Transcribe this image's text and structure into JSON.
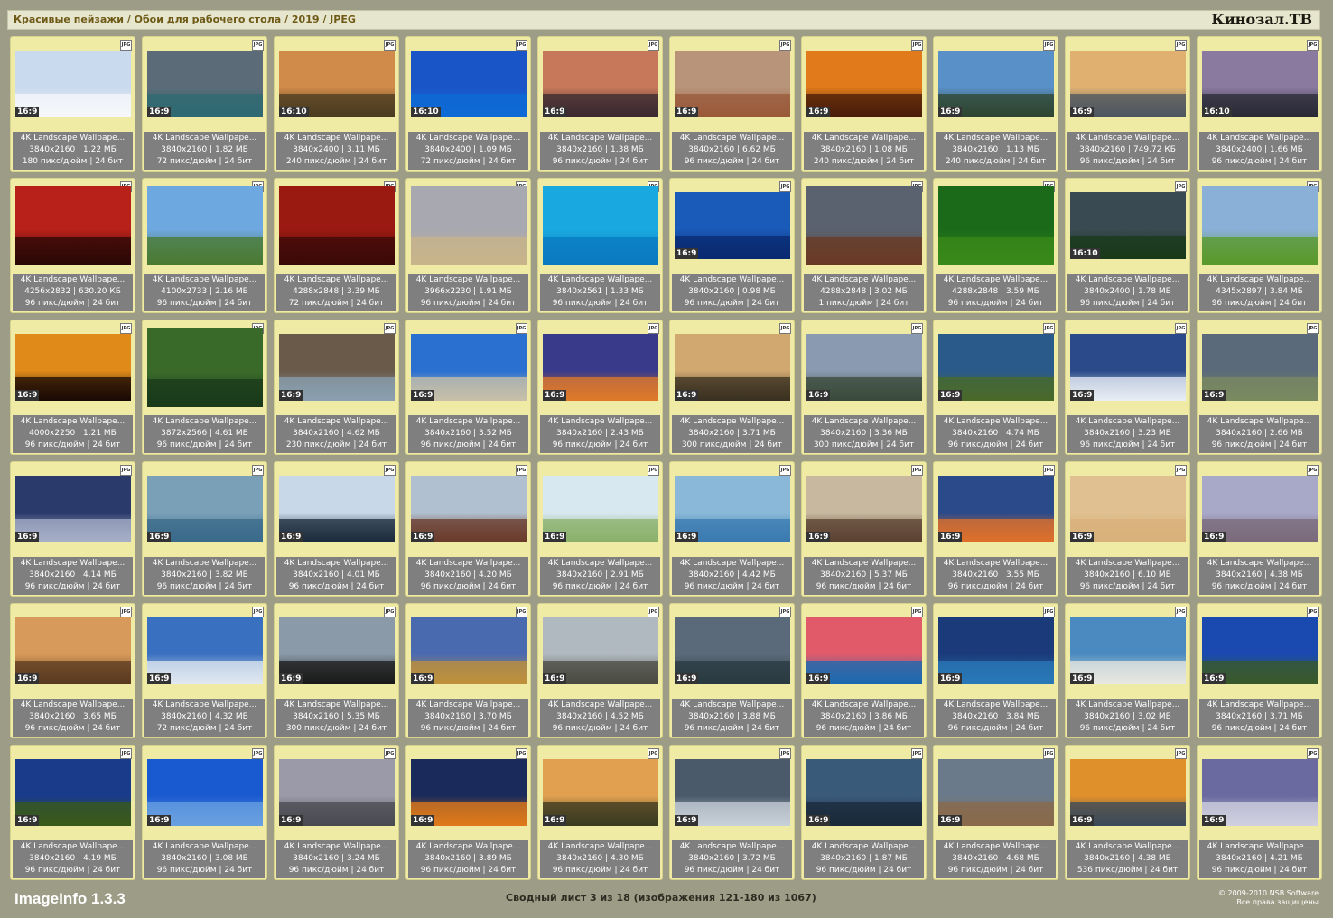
{
  "header": {
    "breadcrumb": "Красивые пейзажи / Обои для рабочего стола / 2019 / JPEG",
    "brand": "Кинозал.ТВ"
  },
  "badge_label": "JPG",
  "thumbnails": [
    {
      "title": "4K Landscape Wallpape...",
      "ratio": "16:9",
      "dims": "3840x2160 | 1.22 МБ",
      "meta": "180 пикс/дюйм | 24 бит",
      "sky": "#c9d9ee",
      "ground": "#f5f7fa"
    },
    {
      "title": "4K Landscape Wallpape...",
      "ratio": "16:9",
      "dims": "3840x2160 | 1.82 МБ",
      "meta": "72 пикс/дюйм | 24 бит",
      "sky": "#5b6b78",
      "ground": "#2f6a72"
    },
    {
      "title": "4K Landscape Wallpape...",
      "ratio": "16:10",
      "dims": "3840x2400 | 3.11 МБ",
      "meta": "240 пикс/дюйм | 24 бит",
      "sky": "#d08a4a",
      "ground": "#4a3b20"
    },
    {
      "title": "4K Landscape Wallpape...",
      "ratio": "16:10",
      "dims": "3840x2400 | 1.09 МБ",
      "meta": "72 пикс/дюйм | 24 бит",
      "sky": "#1a55c8",
      "ground": "#0e6bd6"
    },
    {
      "title": "4K Landscape Wallpape...",
      "ratio": "16:9",
      "dims": "3840x2160 | 1.38 МБ",
      "meta": "96 пикс/дюйм | 24 бит",
      "sky": "#c8785a",
      "ground": "#3a2a30"
    },
    {
      "title": "4K Landscape Wallpape...",
      "ratio": "16:9",
      "dims": "3840x2160 | 6.62 МБ",
      "meta": "96 пикс/дюйм | 24 бит",
      "sky": "#b8947a",
      "ground": "#9a5a3a"
    },
    {
      "title": "4K Landscape Wallpape...",
      "ratio": "16:9",
      "dims": "3840x2160 | 1.08 МБ",
      "meta": "240 пикс/дюйм | 24 бит",
      "sky": "#e07a1a",
      "ground": "#4a1c0a"
    },
    {
      "title": "4K Landscape Wallpape...",
      "ratio": "16:9",
      "dims": "3840x2160 | 1.13 МБ",
      "meta": "240 пикс/дюйм | 24 бит",
      "sky": "#5a90c8",
      "ground": "#2f4630"
    },
    {
      "title": "4K Landscape Wallpape...",
      "ratio": "16:9",
      "dims": "3840x2160 | 749.72 КБ",
      "meta": "96 пикс/дюйм | 24 бит",
      "sky": "#e0b070",
      "ground": "#4c5560"
    },
    {
      "title": "4K Landscape Wallpape...",
      "ratio": "16:10",
      "dims": "3840x2400 | 1.66 МБ",
      "meta": "96 пикс/дюйм | 24 бит",
      "sky": "#8a7aa0",
      "ground": "#2a2a36"
    },
    {
      "title": "4K Landscape Wallpape...",
      "ratio": "",
      "dims": "4256x2832 | 630.20 КБ",
      "meta": "96 пикс/дюйм | 24 бит",
      "sky": "#b8201a",
      "ground": "#2a0806"
    },
    {
      "title": "4K Landscape Wallpape...",
      "ratio": "",
      "dims": "4100x2733 | 2.16 МБ",
      "meta": "96 пикс/дюйм | 24 бит",
      "sky": "#6ea8e0",
      "ground": "#4a7a30"
    },
    {
      "title": "4K Landscape Wallpape...",
      "ratio": "",
      "dims": "4288x2848 | 3.39 МБ",
      "meta": "72 пикс/дюйм | 24 бит",
      "sky": "#9a1a12",
      "ground": "#3a0a08"
    },
    {
      "title": "4K Landscape Wallpape...",
      "ratio": "",
      "dims": "3966x2230 | 1.91 МБ",
      "meta": "96 пикс/дюйм | 24 бит",
      "sky": "#a8a8b0",
      "ground": "#c8b48a"
    },
    {
      "title": "4K Landscape Wallpape...",
      "ratio": "",
      "dims": "3840x2561 | 1.33 МБ",
      "meta": "96 пикс/дюйм | 24 бит",
      "sky": "#1aa8e0",
      "ground": "#0a7ac0"
    },
    {
      "title": "4K Landscape Wallpape...",
      "ratio": "16:9",
      "dims": "3840x2160 | 0.98 МБ",
      "meta": "96 пикс/дюйм | 24 бит",
      "sky": "#1a5ab8",
      "ground": "#0a2a70"
    },
    {
      "title": "4K Landscape Wallpape...",
      "ratio": "",
      "dims": "4288x2848 | 3.02 МБ",
      "meta": "1 пикс/дюйм | 24 бит",
      "sky": "#5a6270",
      "ground": "#6a3a24"
    },
    {
      "title": "4K Landscape Wallpape...",
      "ratio": "",
      "dims": "4288x2848 | 3.59 МБ",
      "meta": "96 пикс/дюйм | 24 бит",
      "sky": "#1a6a1a",
      "ground": "#3a8a1a"
    },
    {
      "title": "4K Landscape Wallpape...",
      "ratio": "16:10",
      "dims": "3840x2400 | 1.78 МБ",
      "meta": "96 пикс/дюйм | 24 бит",
      "sky": "#3a4a52",
      "ground": "#1a3a1a"
    },
    {
      "title": "4K Landscape Wallpape...",
      "ratio": "",
      "dims": "4345x2897 | 3.84 МБ",
      "meta": "96 пикс/дюйм | 24 бит",
      "sky": "#8ab0d8",
      "ground": "#5a9a2a"
    },
    {
      "title": "4K Landscape Wallpape...",
      "ratio": "16:9",
      "dims": "4000x2250 | 1.21 МБ",
      "meta": "96 пикс/дюйм | 24 бит",
      "sky": "#e08a1a",
      "ground": "#1a0a04"
    },
    {
      "title": "4K Landscape Wallpape...",
      "ratio": "",
      "dims": "3872x2566 | 4.61 МБ",
      "meta": "96 пикс/дюйм | 24 бит",
      "sky": "#3a6a2a",
      "ground": "#1a3a1a"
    },
    {
      "title": "4K Landscape Wallpape...",
      "ratio": "16:9",
      "dims": "3840x2160 | 4.62 МБ",
      "meta": "230 пикс/дюйм | 24 бит",
      "sky": "#6a5a4a",
      "ground": "#8aa0b0"
    },
    {
      "title": "4K Landscape Wallpape...",
      "ratio": "16:9",
      "dims": "3840x2160 | 3.52 МБ",
      "meta": "96 пикс/дюйм | 24 бит",
      "sky": "#2a70d0",
      "ground": "#c8c0a8"
    },
    {
      "title": "4K Landscape Wallpape...",
      "ratio": "16:9",
      "dims": "3840x2160 | 2.43 МБ",
      "meta": "96 пикс/дюйм | 24 бит",
      "sky": "#3a3a8a",
      "ground": "#e07a2a"
    },
    {
      "title": "4K Landscape Wallpape...",
      "ratio": "16:9",
      "dims": "3840x2160 | 3.71 МБ",
      "meta": "300 пикс/дюйм | 24 бит",
      "sky": "#d0a870",
      "ground": "#3a3020"
    },
    {
      "title": "4K Landscape Wallpape...",
      "ratio": "16:9",
      "dims": "3840x2160 | 3.36 МБ",
      "meta": "300 пикс/дюйм | 24 бит",
      "sky": "#8a9ab0",
      "ground": "#3a4a3a"
    },
    {
      "title": "4K Landscape Wallpape...",
      "ratio": "16:9",
      "dims": "3840x2160 | 4.74 МБ",
      "meta": "96 пикс/дюйм | 24 бит",
      "sky": "#2a5a8a",
      "ground": "#4a6a2a"
    },
    {
      "title": "4K Landscape Wallpape...",
      "ratio": "16:9",
      "dims": "3840x2160 | 3.23 МБ",
      "meta": "96 пикс/дюйм | 24 бит",
      "sky": "#2a4a8a",
      "ground": "#e8eef4"
    },
    {
      "title": "4K Landscape Wallpape...",
      "ratio": "16:9",
      "dims": "3840x2160 | 2.66 МБ",
      "meta": "96 пикс/дюйм | 24 бит",
      "sky": "#5a6a7a",
      "ground": "#7a8a60"
    },
    {
      "title": "4K Landscape Wallpape...",
      "ratio": "16:9",
      "dims": "3840x2160 | 4.14 МБ",
      "meta": "96 пикс/дюйм | 24 бит",
      "sky": "#2a3a6a",
      "ground": "#a8b0c8"
    },
    {
      "title": "4K Landscape Wallpape...",
      "ratio": "16:9",
      "dims": "3840x2160 | 3.82 МБ",
      "meta": "96 пикс/дюйм | 24 бит",
      "sky": "#7aa0b8",
      "ground": "#3a6a8a"
    },
    {
      "title": "4K Landscape Wallpape...",
      "ratio": "16:9",
      "dims": "3840x2160 | 4.01 МБ",
      "meta": "96 пикс/дюйм | 24 бит",
      "sky": "#c8d8e8",
      "ground": "#1a2a3a"
    },
    {
      "title": "4K Landscape Wallpape...",
      "ratio": "16:9",
      "dims": "3840x2160 | 4.20 МБ",
      "meta": "96 пикс/дюйм | 24 бит",
      "sky": "#b0c0d0",
      "ground": "#6a3a2a"
    },
    {
      "title": "4K Landscape Wallpape...",
      "ratio": "16:9",
      "dims": "3840x2160 | 2.91 МБ",
      "meta": "96 пикс/дюйм | 24 бит",
      "sky": "#d8e8f0",
      "ground": "#8ab06a"
    },
    {
      "title": "4K Landscape Wallpape...",
      "ratio": "16:9",
      "dims": "3840x2160 | 4.42 МБ",
      "meta": "96 пикс/дюйм | 24 бит",
      "sky": "#8ab8d8",
      "ground": "#3a7ab0"
    },
    {
      "title": "4K Landscape Wallpape...",
      "ratio": "16:9",
      "dims": "3840x2160 | 5.37 МБ",
      "meta": "96 пикс/дюйм | 24 бит",
      "sky": "#c8b8a0",
      "ground": "#5a4030"
    },
    {
      "title": "4K Landscape Wallpape...",
      "ratio": "16:9",
      "dims": "3840x2160 | 3.55 МБ",
      "meta": "96 пикс/дюйм | 24 бит",
      "sky": "#2a4a8a",
      "ground": "#e0702a"
    },
    {
      "title": "4K Landscape Wallpape...",
      "ratio": "16:9",
      "dims": "3840x2160 | 6.10 МБ",
      "meta": "96 пикс/дюйм | 24 бит",
      "sky": "#e0c090",
      "ground": "#d8b07a"
    },
    {
      "title": "4K Landscape Wallpape...",
      "ratio": "16:9",
      "dims": "3840x2160 | 4.38 МБ",
      "meta": "96 пикс/дюйм | 24 бит",
      "sky": "#a8a8c8",
      "ground": "#7a6a7a"
    },
    {
      "title": "4K Landscape Wallpape...",
      "ratio": "16:9",
      "dims": "3840x2160 | 3.65 МБ",
      "meta": "96 пикс/дюйм | 24 бит",
      "sky": "#d89a5a",
      "ground": "#5a3a20"
    },
    {
      "title": "4K Landscape Wallpape...",
      "ratio": "16:9",
      "dims": "3840x2160 | 4.32 МБ",
      "meta": "72 пикс/дюйм | 24 бит",
      "sky": "#3a70c0",
      "ground": "#e0e8f0"
    },
    {
      "title": "4K Landscape Wallpape...",
      "ratio": "16:9",
      "dims": "3840x2160 | 5.35 МБ",
      "meta": "300 пикс/дюйм | 24 бит",
      "sky": "#8a9aa8",
      "ground": "#1a1a1a"
    },
    {
      "title": "4K Landscape Wallpape...",
      "ratio": "16:9",
      "dims": "3840x2160 | 3.70 МБ",
      "meta": "96 пикс/дюйм | 24 бит",
      "sky": "#4a6ab0",
      "ground": "#c0903a"
    },
    {
      "title": "4K Landscape Wallpape...",
      "ratio": "16:9",
      "dims": "3840x2160 | 4.52 МБ",
      "meta": "96 пикс/дюйм | 24 бит",
      "sky": "#b0b8c0",
      "ground": "#4a4a40"
    },
    {
      "title": "4K Landscape Wallpape...",
      "ratio": "16:9",
      "dims": "3840x2160 | 3.88 МБ",
      "meta": "96 пикс/дюйм | 24 бит",
      "sky": "#5a6a7a",
      "ground": "#2a3a40"
    },
    {
      "title": "4K Landscape Wallpape...",
      "ratio": "16:9",
      "dims": "3840x2160 | 3.86 МБ",
      "meta": "96 пикс/дюйм | 24 бит",
      "sky": "#e05a6a",
      "ground": "#1a6ab0"
    },
    {
      "title": "4K Landscape Wallpape...",
      "ratio": "16:9",
      "dims": "3840x2160 | 3.84 МБ",
      "meta": "96 пикс/дюйм | 24 бит",
      "sky": "#1a3a7a",
      "ground": "#2a7ab8"
    },
    {
      "title": "4K Landscape Wallpape...",
      "ratio": "16:9",
      "dims": "3840x2160 | 3.02 МБ",
      "meta": "96 пикс/дюйм | 24 бит",
      "sky": "#4a8ac0",
      "ground": "#e8e8e0"
    },
    {
      "title": "4K Landscape Wallpape...",
      "ratio": "16:9",
      "dims": "3840x2160 | 3.71 МБ",
      "meta": "96 пикс/дюйм | 24 бит",
      "sky": "#1a4ab0",
      "ground": "#3a5a2a"
    },
    {
      "title": "4K Landscape Wallpape...",
      "ratio": "16:9",
      "dims": "3840x2160 | 4.19 МБ",
      "meta": "96 пикс/дюйм | 24 бит",
      "sky": "#1a3a8a",
      "ground": "#3a5a1a"
    },
    {
      "title": "4K Landscape Wallpape...",
      "ratio": "16:9",
      "dims": "3840x2160 | 3.08 МБ",
      "meta": "96 пикс/дюйм | 24 бит",
      "sky": "#1a5ad0",
      "ground": "#6aa0e0"
    },
    {
      "title": "4K Landscape Wallpape...",
      "ratio": "16:9",
      "dims": "3840x2160 | 3.24 МБ",
      "meta": "96 пикс/дюйм | 24 бит",
      "sky": "#9a9aa8",
      "ground": "#4a4a50"
    },
    {
      "title": "4K Landscape Wallpape...",
      "ratio": "16:9",
      "dims": "3840x2160 | 3.89 МБ",
      "meta": "96 пикс/дюйм | 24 бит",
      "sky": "#1a2a5a",
      "ground": "#e07a1a"
    },
    {
      "title": "4K Landscape Wallpape...",
      "ratio": "16:9",
      "dims": "3840x2160 | 4.30 МБ",
      "meta": "96 пикс/дюйм | 24 бит",
      "sky": "#e0a050",
      "ground": "#3a3a20"
    },
    {
      "title": "4K Landscape Wallpape...",
      "ratio": "16:9",
      "dims": "3840x2160 | 3.72 МБ",
      "meta": "96 пикс/дюйм | 24 бит",
      "sky": "#4a5a6a",
      "ground": "#c8d0d8"
    },
    {
      "title": "4K Landscape Wallpape...",
      "ratio": "16:9",
      "dims": "3840x2160 | 1.87 МБ",
      "meta": "96 пикс/дюйм | 24 бит",
      "sky": "#3a5a7a",
      "ground": "#1a2a3a"
    },
    {
      "title": "4K Landscape Wallpape...",
      "ratio": "16:9",
      "dims": "3840x2160 | 4.68 МБ",
      "meta": "96 пикс/дюйм | 24 бит",
      "sky": "#6a7a8a",
      "ground": "#8a6a4a"
    },
    {
      "title": "4K Landscape Wallpape...",
      "ratio": "16:9",
      "dims": "3840x2160 | 4.38 МБ",
      "meta": "536 пикс/дюйм | 24 бит",
      "sky": "#e0902a",
      "ground": "#3a4a5a"
    },
    {
      "title": "4K Landscape Wallpape...",
      "ratio": "16:9",
      "dims": "3840x2160 | 4.21 МБ",
      "meta": "96 пикс/дюйм | 24 бит",
      "sky": "#6a6aa0",
      "ground": "#d0d0e0"
    }
  ],
  "footer": {
    "app_name": "ImageInfo 1.3.3",
    "summary": "Сводный лист 3 из 18 (изображения 121-180 из 1067)",
    "copyright": "© 2009-2010 NSB Software",
    "rights": "Все права защищены"
  }
}
